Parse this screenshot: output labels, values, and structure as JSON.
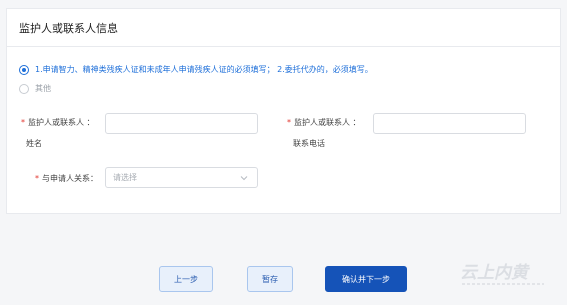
{
  "section": {
    "title": "监护人或联系人信息"
  },
  "options": {
    "selected_label": "1.申请智力、精神类残疾人证和未成年人申请残疾人证的必须填写；  2.委托代办的，必须填写。",
    "other_label": "其他"
  },
  "form": {
    "required_mark": "*",
    "guardian_name_label_line1": "监护人或联系人  ：",
    "guardian_name_label_line2": "姓名",
    "guardian_phone_label_line1": "监护人或联系人  ：",
    "guardian_phone_label_line2": "联系电话",
    "relation_label": "与申请人关系：",
    "relation_placeholder": "请选择"
  },
  "buttons": {
    "prev": "上一步",
    "save": "暂存",
    "confirm_next": "确认并下一步"
  },
  "watermark": {
    "text": "云上内黄"
  },
  "colors": {
    "accent": "#1553b8",
    "link": "#1e6fd9",
    "required": "#e2342d"
  }
}
